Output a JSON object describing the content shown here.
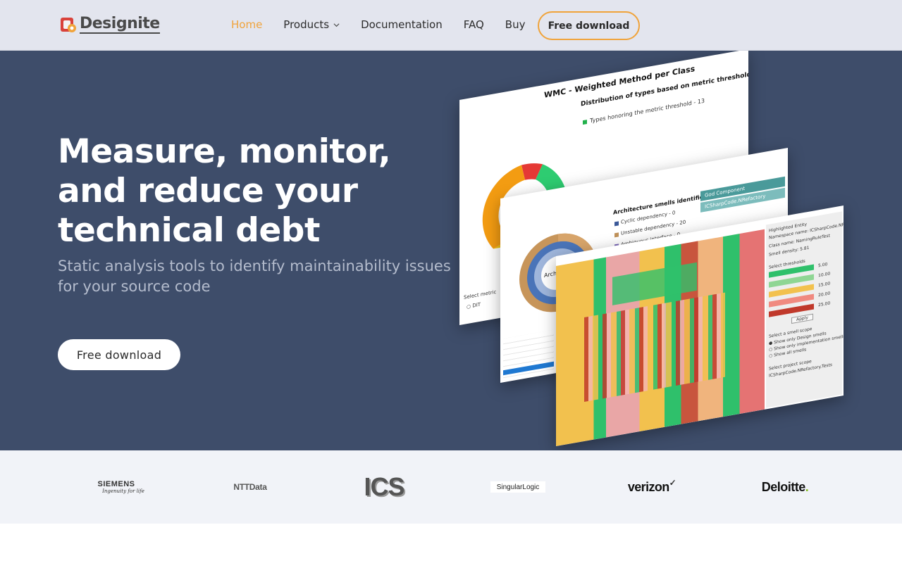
{
  "nav": {
    "logo_text": "Designite",
    "links": [
      {
        "label": "Home",
        "active": true
      },
      {
        "label": "Products",
        "has_dropdown": true
      },
      {
        "label": "Documentation"
      },
      {
        "label": "FAQ"
      },
      {
        "label": "Buy"
      }
    ],
    "cta_label": "Free download",
    "accent_color": "#f0a33a"
  },
  "hero": {
    "title": "Measure, monitor, and reduce your technical debt",
    "subtitle": "Static analysis tools to identify maintainability issues for your source code",
    "cta_label": "Free download",
    "background_color": "#3e4d6a"
  },
  "screenshots": {
    "wmc_panel": {
      "title": "WMC - Weighted Method per Class",
      "heading": "Distribution of types based on metric thresholds",
      "legend_line": "Types honoring the metric threshold - 13",
      "select_metric": "Select metric",
      "radio_dit": "DIT"
    },
    "arch_panel": {
      "heading": "Architecture smells identified",
      "items": [
        "Cyclic dependency - 0",
        "Unstable dependency - 20",
        "Ambiguous interface - 0"
      ],
      "center_label": "Arch. Smells",
      "tag1": "God Component",
      "tag2": "ICSharpCode.NRefactory"
    },
    "design_panel": {
      "highlighted": "Highlighted Entity",
      "namespace": "Namespace name: ICSharpCode.NRefac",
      "class_name": "Class name: NamingRuleTest",
      "density": "Smell density: 5.81",
      "select_thresholds": "Select thresholds",
      "thresholds": [
        "5.00",
        "10.00",
        "15.00",
        "20.00",
        "25.00"
      ],
      "apply": "Apply",
      "scope_title": "Select a smell scope",
      "scope_options": [
        "Show only Design smells",
        "Show only implementation smells",
        "Show all smells"
      ],
      "project_scope": "Select project scope",
      "project_value": "ICSharpCode.NRefactory.Tests"
    }
  },
  "clients": {
    "siemens": "SIEMENS",
    "siemens_tagline": "Ingenuity for life",
    "ntt": "NTTData",
    "ics": "ICS",
    "singular": "SingularLogic",
    "verizon": "verizon",
    "deloitte": "Deloitte"
  }
}
